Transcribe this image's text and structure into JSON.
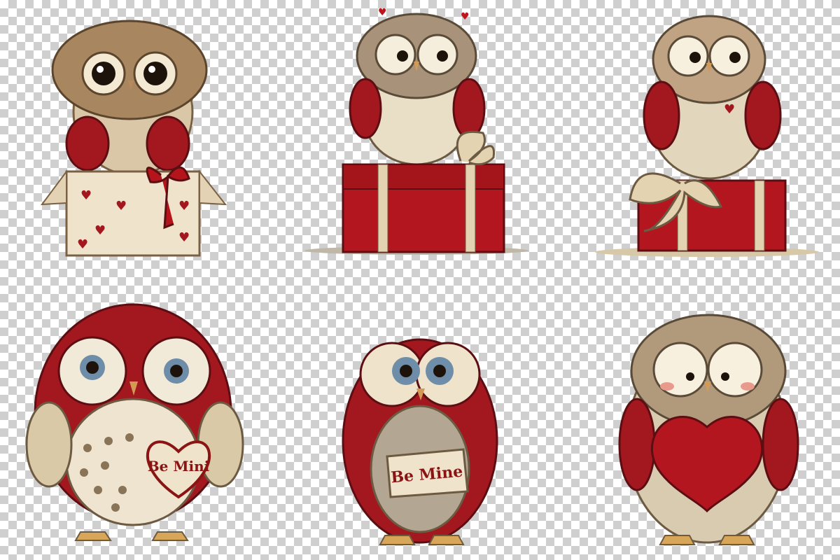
{
  "image": {
    "background": "transparency-checkerboard",
    "palette": {
      "red": "#a3181f",
      "dark_red": "#6e0f14",
      "cream": "#efe6d2",
      "brown": "#9a7a57",
      "tan": "#c9b290",
      "gold": "#d8a659"
    },
    "owls": [
      {
        "icon": "owl-in-gift-box-icon",
        "sign_text": ""
      },
      {
        "icon": "owl-on-red-gift-icon",
        "sign_text": ""
      },
      {
        "icon": "owl-on-red-gift-icon",
        "sign_text": ""
      },
      {
        "icon": "red-owl-with-heart-sign-icon",
        "sign_text": "Be Mini"
      },
      {
        "icon": "red-owl-with-banner-icon",
        "sign_text": "Be Mine"
      },
      {
        "icon": "owl-holding-heart-icon",
        "sign_text": ""
      }
    ]
  }
}
